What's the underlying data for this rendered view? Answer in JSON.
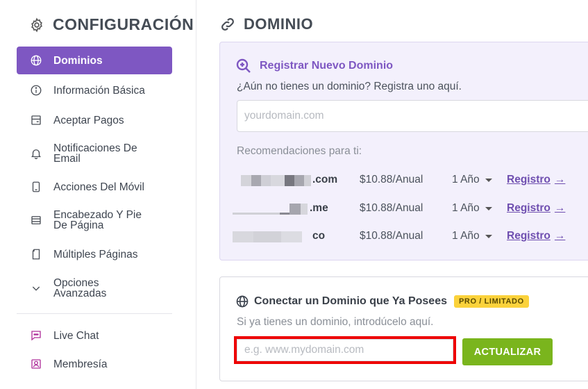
{
  "sidebar": {
    "title": "CONFIGURACIÓN",
    "items": [
      {
        "label": "Dominios",
        "icon": "globe-icon",
        "active": true
      },
      {
        "label": "Información Básica",
        "icon": "info-icon"
      },
      {
        "label": "Aceptar Pagos",
        "icon": "credit-card-icon"
      },
      {
        "label": "Notificaciones De Email",
        "icon": "bell-icon"
      },
      {
        "label": "Acciones Del Móvil",
        "icon": "mobile-icon"
      },
      {
        "label": "Encabezado Y Pie De Página",
        "icon": "layout-icon"
      },
      {
        "label": "Múltiples Páginas",
        "icon": "pages-icon"
      },
      {
        "label": "Opciones Avanzadas",
        "icon": "chevron-down-icon"
      },
      {
        "label": "Live Chat",
        "icon": "chat-icon"
      },
      {
        "label": "Membresía",
        "icon": "member-icon"
      }
    ]
  },
  "main": {
    "title": "DOMINIO",
    "register": {
      "title": "Registrar Nuevo Dominio",
      "subtitle": "¿Aún no tienes un dominio? Registra uno aquí.",
      "placeholder": "yourdomain.com",
      "recommendations_title": "Recomendaciones para ti:",
      "recommendations": [
        {
          "tld": ".com",
          "price": "$10.88/Anual",
          "term": "1 Año",
          "link": "Registro"
        },
        {
          "tld": ".me",
          "price": "$10.88/Anual",
          "term": "1 Año",
          "link": "Registro"
        },
        {
          "tld": "co",
          "price": "$10.88/Anual",
          "term": "1 Año",
          "link": "Registro"
        }
      ]
    },
    "connect": {
      "title": "Conectar un Dominio que Ya Posees",
      "badge": "PRO / LIMITADO",
      "subtitle": "Si ya tienes un dominio, introdúcelo aquí.",
      "placeholder": "e.g. www.mydomain.com",
      "button": "ACTUALIZAR"
    }
  },
  "colors": {
    "accent": "#7e57c2",
    "button_green": "#7ab51d",
    "badge_yellow": "#fbd23b",
    "highlight_red": "#ee0000"
  }
}
